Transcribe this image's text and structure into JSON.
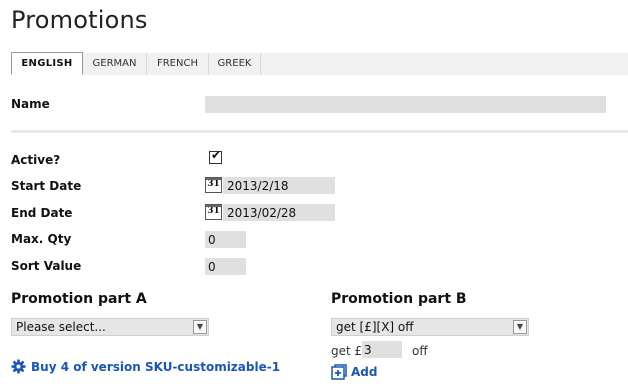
{
  "page": {
    "title": "Promotions"
  },
  "tabs": [
    {
      "label": "ENGLISH",
      "active": true
    },
    {
      "label": "GERMAN",
      "active": false
    },
    {
      "label": "FRENCH",
      "active": false
    },
    {
      "label": "GREEK",
      "active": false
    }
  ],
  "form": {
    "name": {
      "label": "Name",
      "value": ""
    },
    "active": {
      "label": "Active?",
      "checked": true,
      "check_glyph": "✔"
    },
    "start_date": {
      "label": "Start Date",
      "value": "2013/2/18",
      "icon_text": "31"
    },
    "end_date": {
      "label": "End Date",
      "value": "2013/02/28",
      "icon_text": "31"
    },
    "max_qty": {
      "label": "Max. Qty",
      "value": "0"
    },
    "sort_value": {
      "label": "Sort Value",
      "value": "0"
    }
  },
  "part_a": {
    "title": "Promotion part A",
    "select_value": "Please select...",
    "link_text": "Buy 4 of version SKU-customizable-1"
  },
  "part_b": {
    "title": "Promotion part B",
    "select_value": "get [£][X] off",
    "get_prefix": "get £",
    "get_value": "3",
    "off_suffix": "off",
    "add_label": "Add"
  },
  "colors": {
    "link": "#1a56b8",
    "field": "#e0e0e0"
  }
}
